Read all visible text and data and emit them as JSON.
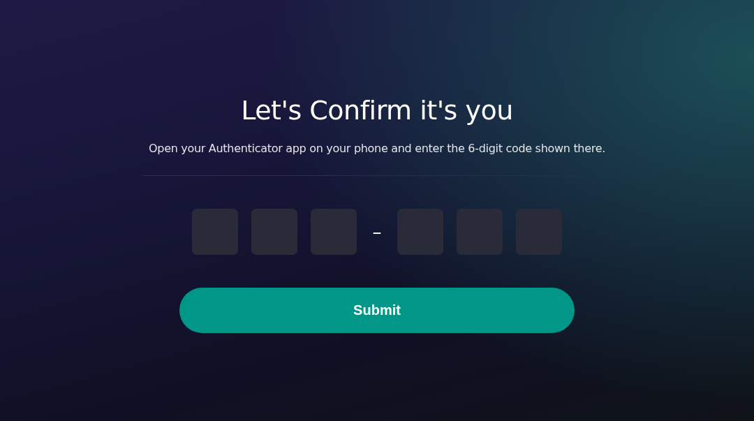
{
  "title": "Let's Confirm it's you",
  "subtitle": "Open your Authenticator app on your phone and enter the 6-digit code shown there.",
  "code_inputs": [
    {
      "kind": "digit"
    },
    {
      "kind": "digit"
    },
    {
      "kind": "digit"
    },
    {
      "kind": "separator",
      "text": "–"
    },
    {
      "kind": "digit"
    },
    {
      "kind": "digit"
    },
    {
      "kind": "digit"
    }
  ],
  "submit_button": {
    "label": "Submit"
  }
}
